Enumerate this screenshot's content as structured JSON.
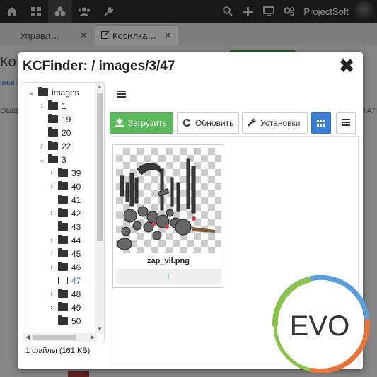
{
  "topbar": {
    "icons": [
      "dashboard-icon",
      "sitemap-icon",
      "elements-icon",
      "users-icon",
      "tools-icon"
    ],
    "right_icons": [
      "search-icon",
      "plus-icon",
      "monitor-icon",
      "settings-icon"
    ],
    "username": "ProjectSoft"
  },
  "tabs": [
    {
      "label": "Управл…",
      "close": "✕"
    },
    {
      "label": "Косилка…",
      "close": "✕"
    }
  ],
  "background": {
    "title": "Ко",
    "crumb": "вная",
    "tab_left": "ОБЩ",
    "tab_right": "АТАЛ"
  },
  "dialog": {
    "title": "KCFinder: / images/3/47",
    "close": "✖"
  },
  "tree": {
    "items": [
      {
        "label": "images",
        "chevron": "⌄"
      },
      {
        "label": "1",
        "chevron": "›"
      },
      {
        "label": "19",
        "chevron": ""
      },
      {
        "label": "20",
        "chevron": ""
      },
      {
        "label": "22",
        "chevron": "›"
      },
      {
        "label": "3",
        "chevron": "⌄"
      },
      {
        "label": "39",
        "chevron": "›"
      },
      {
        "label": "40",
        "chevron": "›"
      },
      {
        "label": "41",
        "chevron": ""
      },
      {
        "label": "42",
        "chevron": "›"
      },
      {
        "label": "43",
        "chevron": ""
      },
      {
        "label": "44",
        "chevron": "›"
      },
      {
        "label": "45",
        "chevron": "›"
      },
      {
        "label": "46",
        "chevron": "›"
      },
      {
        "label": "47",
        "chevron": "",
        "selected": true
      },
      {
        "label": "48",
        "chevron": "›"
      },
      {
        "label": "49",
        "chevron": "›"
      },
      {
        "label": "50",
        "chevron": ""
      }
    ]
  },
  "toolbar": {
    "upload": "Загрузить",
    "refresh": "Обновить",
    "settings": "Установки"
  },
  "file": {
    "name": "zap_vil.png",
    "add": "+"
  },
  "status": "1 файлы (161 KB)",
  "logo": {
    "text": "EVO"
  },
  "colors": {
    "green": "#5cb85c",
    "blue": "#3a7fd5",
    "selected": "#3a7fc0"
  }
}
